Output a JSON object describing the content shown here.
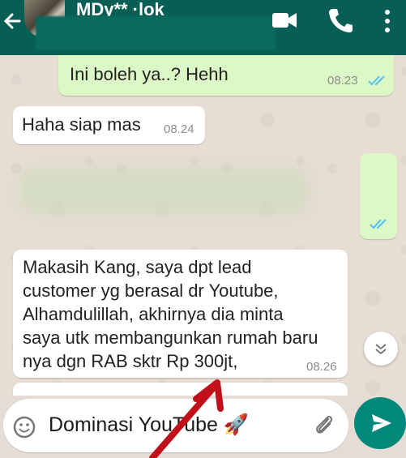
{
  "header": {
    "contact_name": "MDy** ·lok",
    "icons": [
      "back-arrow-icon",
      "avatar",
      "video-call-icon",
      "phone-icon",
      "more-vert-icon"
    ],
    "color": "#075e54"
  },
  "messages": [
    {
      "direction": "outgoing",
      "text": "Ini boleh ya..? Hehh",
      "time": "08.23",
      "status": "read"
    },
    {
      "direction": "incoming",
      "text": "Haha siap mas",
      "time": "08.24"
    },
    {
      "direction": "outgoing",
      "text": "",
      "time": "",
      "status": "read"
    },
    {
      "direction": "incoming",
      "lines": [
        "Makasih Kang, saya dpt lead",
        "customer yg berasal dr Youtube,",
        "Alhamdulillah, akhirnya dia minta",
        "saya utk membangunkan rumah baru",
        "nya dgn RAB sktr Rp 300jt,"
      ],
      "time": "08.26"
    }
  ],
  "composer": {
    "text": "Dominasi YouTube",
    "emoji": "🚀"
  },
  "colors": {
    "outgoing_bubble": "#dcf8c6",
    "incoming_bubble": "#ffffff",
    "read_ticks": "#4fc3f7",
    "send_button": "#00897b",
    "annotation_arrow": "#c0101a"
  }
}
